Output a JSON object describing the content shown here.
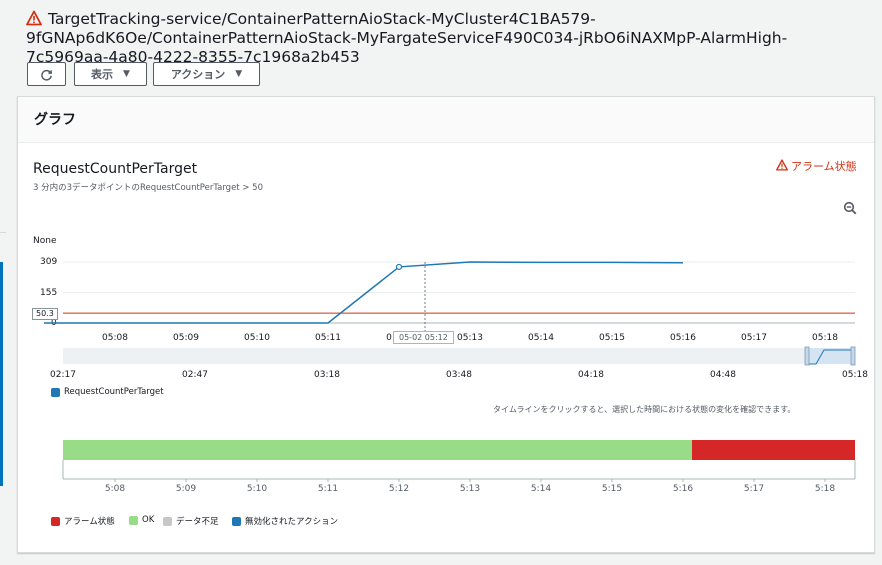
{
  "alarm": {
    "title": "TargetTracking-service/ContainerPatternAioStack-MyCluster4C1BA579-9fGNAp6dK6Oe/ContainerPatternAioStack-MyFargateServiceF490C034-jRbO6iNAXMpP-AlarmHigh-7c5969aa-4a80-4222-8355-7c1968a2b453"
  },
  "toolbar": {
    "refresh_icon": "refresh-icon",
    "view_label": "表示",
    "actions_label": "アクション"
  },
  "panel": {
    "heading": "グラフ"
  },
  "chart": {
    "title": "RequestCountPerTarget",
    "subtitle": "3 分内の3データポイントのRequestCountPerTarget > 50",
    "state_label": "アラーム状態",
    "y_unit": "None",
    "threshold_label": "50.3",
    "hover_tooltip": "05-02 05:12",
    "partial_tick": "0",
    "legend_series": "RequestCountPerTarget",
    "colors": {
      "series": "#1f77b4",
      "threshold": "#d13212",
      "ok": "#98dc87",
      "alarm": "#d62728"
    }
  },
  "chart_data": {
    "type": "line",
    "title": "RequestCountPerTarget",
    "y_ticks": [
      "309",
      "155",
      "0"
    ],
    "ylim": [
      0,
      309
    ],
    "x_ticks": [
      "05:08",
      "05:09",
      "05:10",
      "05:11",
      "05:13",
      "05:14",
      "05:15",
      "05:16",
      "05:17",
      "05:18"
    ],
    "series": [
      {
        "name": "RequestCountPerTarget",
        "x": [
          "05:07",
          "05:08",
          "05:09",
          "05:10",
          "05:11",
          "05:12",
          "05:13",
          "05:14",
          "05:15",
          "05:16"
        ],
        "y": [
          0,
          0,
          0,
          0,
          0,
          284,
          309,
          307,
          307,
          305
        ]
      }
    ],
    "threshold": 50.3,
    "grid": true
  },
  "navigator": {
    "ticks": [
      "02:17",
      "02:47",
      "03:18",
      "03:48",
      "04:18",
      "04:48",
      "05:18"
    ]
  },
  "timeline": {
    "hint": "タイムラインをクリックすると、選択した時間における状態の変化を確認できます。",
    "ticks": [
      "5:08",
      "5:09",
      "5:10",
      "5:11",
      "5:12",
      "5:13",
      "5:14",
      "5:15",
      "5:16",
      "5:17",
      "5:18"
    ],
    "ok_until": "05:16",
    "legend": [
      "アラーム状態",
      "OK",
      "データ不足",
      "無効化されたアクション"
    ],
    "legend_colors": [
      "#d62728",
      "#98dc87",
      "#c7c7c7",
      "#1f77b4"
    ]
  }
}
